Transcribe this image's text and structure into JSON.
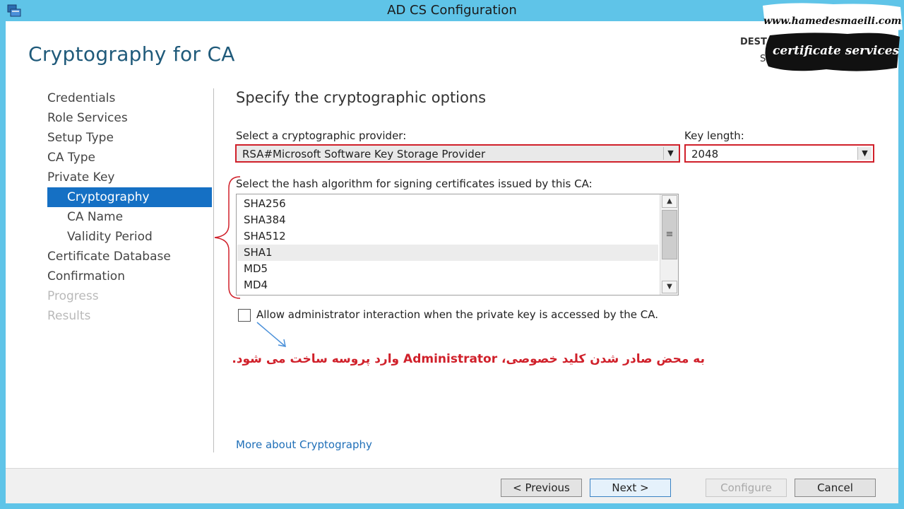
{
  "window": {
    "title": "AD CS Configuration"
  },
  "header": {
    "page_title": "Cryptography for CA",
    "destination_label": "DEST",
    "destination_value": "Se"
  },
  "nav": {
    "items": [
      {
        "label": "Credentials",
        "state": "normal"
      },
      {
        "label": "Role Services",
        "state": "normal"
      },
      {
        "label": "Setup Type",
        "state": "normal"
      },
      {
        "label": "CA Type",
        "state": "normal"
      },
      {
        "label": "Private Key",
        "state": "normal"
      },
      {
        "label": "Cryptography",
        "state": "active"
      },
      {
        "label": "CA Name",
        "state": "normal"
      },
      {
        "label": "Validity Period",
        "state": "normal"
      },
      {
        "label": "Certificate Database",
        "state": "normal"
      },
      {
        "label": "Confirmation",
        "state": "normal"
      },
      {
        "label": "Progress",
        "state": "disabled"
      },
      {
        "label": "Results",
        "state": "disabled"
      }
    ]
  },
  "main": {
    "section_title": "Specify the cryptographic options",
    "provider_label": "Select a cryptographic provider:",
    "provider_value": "RSA#Microsoft Software Key Storage Provider",
    "key_length_label": "Key length:",
    "key_length_value": "2048",
    "hash_label": "Select the hash algorithm for signing certificates issued by this CA:",
    "hash_items": [
      "SHA256",
      "SHA384",
      "SHA512",
      "SHA1",
      "MD5",
      "MD4"
    ],
    "hash_selected": "SHA1",
    "checkbox_label": "Allow administrator interaction when the private key is accessed by the CA.",
    "checkbox_checked": false,
    "annotation": "به محض صادر شدن کلید خصوصی، Administrator وارد پروسه ساخت می شود.",
    "more_link": "More about Cryptography"
  },
  "footer": {
    "previous": "< Previous",
    "next": "Next >",
    "configure": "Configure",
    "cancel": "Cancel"
  },
  "watermark": {
    "url": "www.hamedesmaeili.com",
    "tag": "certificate services"
  },
  "colors": {
    "accent": "#1570c4",
    "highlight_red": "#d0202a",
    "chrome": "#5fc4e8"
  }
}
